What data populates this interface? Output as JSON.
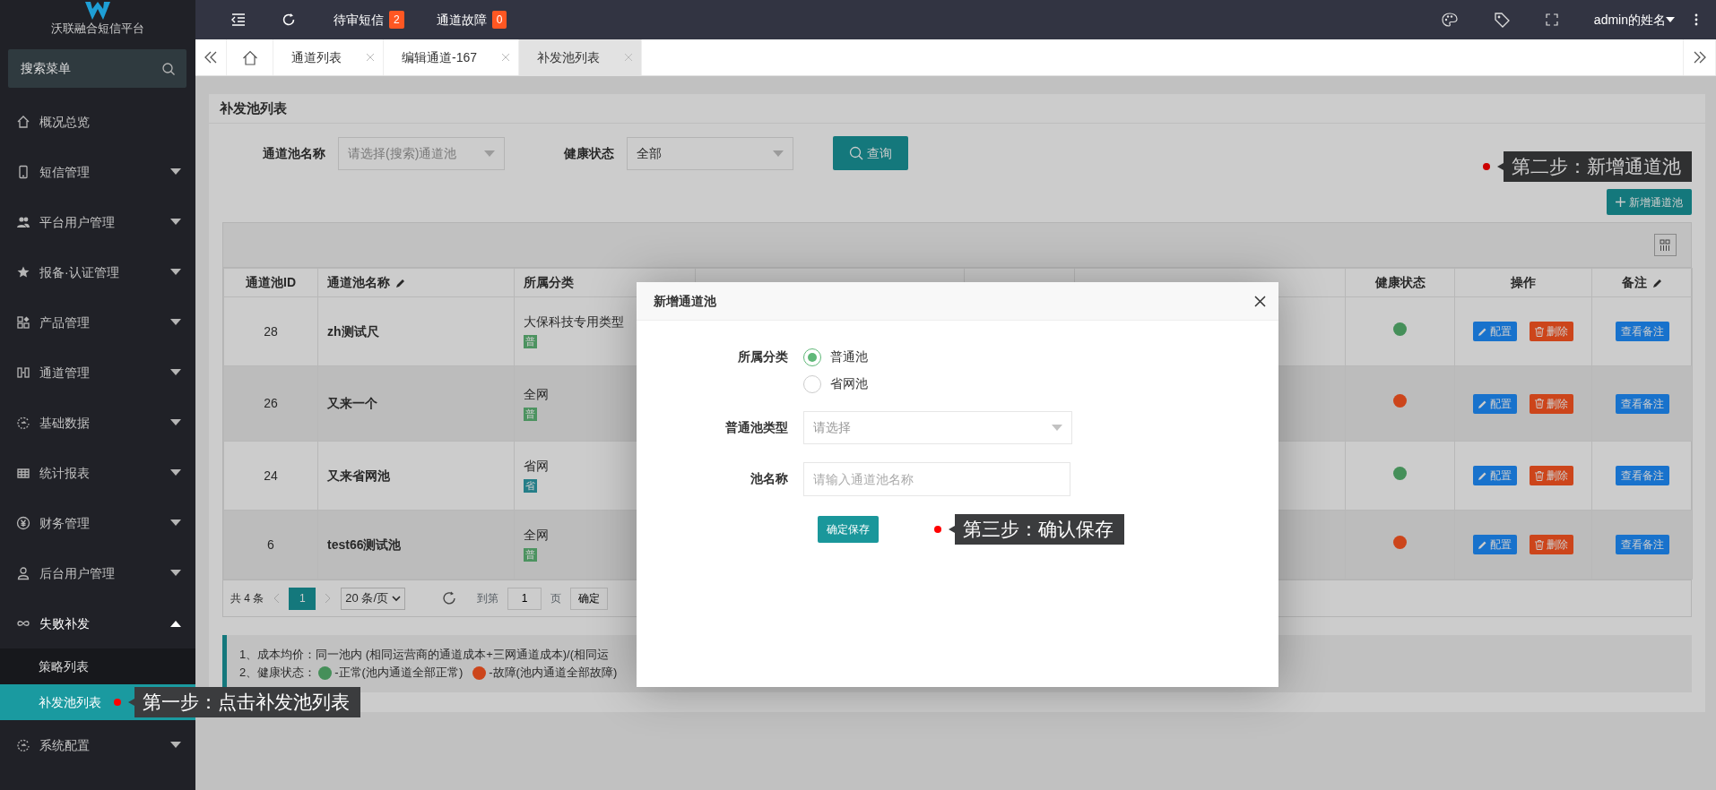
{
  "brand": {
    "name": "沃联融合短信平台"
  },
  "sidebar": {
    "search": {
      "placeholder": "搜索菜单"
    },
    "items": [
      {
        "label": "概况总览",
        "kind": "link"
      },
      {
        "label": "短信管理",
        "kind": "group",
        "expanded": false
      },
      {
        "label": "平台用户管理",
        "kind": "group",
        "expanded": false
      },
      {
        "label": "报备·认证管理",
        "kind": "group",
        "expanded": false
      },
      {
        "label": "产品管理",
        "kind": "group",
        "expanded": false
      },
      {
        "label": "通道管理",
        "kind": "group",
        "expanded": false
      },
      {
        "label": "基础数据",
        "kind": "group",
        "expanded": false
      },
      {
        "label": "统计报表",
        "kind": "group",
        "expanded": false
      },
      {
        "label": "财务管理",
        "kind": "group",
        "expanded": false
      },
      {
        "label": "后台用户管理",
        "kind": "group",
        "expanded": false
      },
      {
        "label": "失败补发",
        "kind": "group",
        "expanded": true,
        "children": [
          {
            "label": "策略列表",
            "selected": false
          },
          {
            "label": "补发池列表",
            "selected": true,
            "callout": "第一步：点击补发池列表"
          }
        ]
      },
      {
        "label": "系统配置",
        "kind": "group",
        "expanded": false
      }
    ]
  },
  "topbar": {
    "alerts": [
      {
        "label": "待审短信",
        "count": "2"
      },
      {
        "label": "通道故障",
        "count": "0"
      }
    ],
    "user": "admin的姓名"
  },
  "tabs": [
    {
      "label": "通道列表",
      "selected": false
    },
    {
      "label": "编辑通道-167",
      "selected": false
    },
    {
      "label": "补发池列表",
      "selected": true
    }
  ],
  "page": {
    "title": "补发池列表",
    "filters": [
      {
        "label": "通道池名称",
        "placeholder": "请选择(搜索)通道池"
      },
      {
        "label": "健康状态",
        "value": "全部"
      }
    ],
    "search_button": "查询",
    "add_button": {
      "label": "新增通道池",
      "callout": "第二步：新增通道池"
    }
  },
  "table": {
    "columns": [
      {
        "label": "通道池ID"
      },
      {
        "label": "通道池名称",
        "editable": true
      },
      {
        "label": "所属分类"
      },
      {
        "label": "健康状态"
      },
      {
        "label": "操作"
      },
      {
        "label": "备注",
        "editable": true
      }
    ],
    "rows": [
      {
        "id": "28",
        "name": "zh测试尺",
        "category": "大保科技专用类型",
        "tag": {
          "text": "普",
          "kind": "normal"
        },
        "healthy": true,
        "actions": [
          {
            "kind": "edit",
            "label": "配置"
          },
          {
            "kind": "delete",
            "label": "删除"
          }
        ],
        "note": "查看备注"
      },
      {
        "id": "26",
        "name": "又来一个",
        "category": "全网",
        "tag": {
          "text": "普",
          "kind": "normal"
        },
        "healthy": false,
        "actions": [
          {
            "kind": "edit",
            "label": "配置"
          },
          {
            "kind": "delete",
            "label": "删除"
          }
        ],
        "note": "查看备注"
      },
      {
        "id": "24",
        "name": "又来省网池",
        "category": "省网",
        "tag": {
          "text": "省",
          "kind": "province"
        },
        "healthy": true,
        "actions": [
          {
            "kind": "edit",
            "label": "配置"
          },
          {
            "kind": "delete",
            "label": "删除"
          }
        ],
        "note": "查看备注"
      },
      {
        "id": "6",
        "name": "test66测试池",
        "category": "全网",
        "tag": {
          "text": "普",
          "kind": "normal"
        },
        "healthy": false,
        "actions": [
          {
            "kind": "edit",
            "label": "配置"
          },
          {
            "kind": "delete",
            "label": "删除"
          }
        ],
        "note": "查看备注"
      }
    ]
  },
  "pagination": {
    "total": "共 4 条",
    "pages": [
      {
        "label": "1",
        "selected": true
      }
    ],
    "page_size": "20 条/页",
    "goto_label": "到第",
    "goto_value": "1",
    "page_unit": "页",
    "confirm": "确定"
  },
  "notes": [
    {
      "kind": "text",
      "text": "1、成本均价：同一池内 (相同运营商的通道成本+三网通道成本)/(相同运"
    },
    {
      "kind": "legend",
      "prefix": "2、健康状态：",
      "items": [
        {
          "healthy": true,
          "text": "-正常(池内通道全部正常)"
        },
        {
          "healthy": false,
          "text": "-故障(池内通道全部故障)"
        }
      ]
    }
  ],
  "modal": {
    "title": "新增通道池",
    "fields": [
      {
        "kind": "radio",
        "label": "所属分类",
        "options": [
          {
            "label": "普通池",
            "selected": true
          },
          {
            "label": "省网池",
            "selected": false
          }
        ]
      },
      {
        "kind": "select",
        "label": "普通池类型",
        "placeholder": "请选择"
      },
      {
        "kind": "input",
        "label": "池名称",
        "placeholder": "请输入通道池名称"
      }
    ],
    "submit": "确定保存",
    "callout": "第三步：确认保存"
  }
}
